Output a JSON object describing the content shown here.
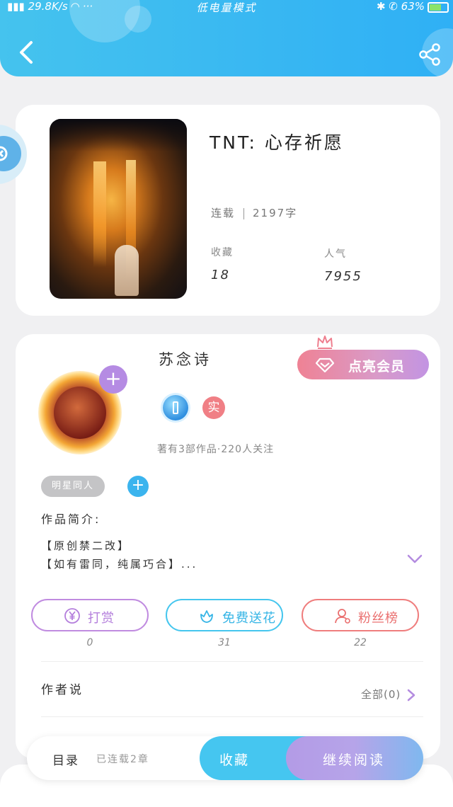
{
  "status_bar": {
    "speed": "29.8K/s",
    "mode": "低电量模式",
    "battery": "63%"
  },
  "book": {
    "title": "TNT: 心存祈愿",
    "serial_status": "连载",
    "word_count": "2197字",
    "collect_label": "收藏",
    "collect_value": "18",
    "popularity_label": "人气",
    "popularity_value": "7955"
  },
  "author": {
    "name": "苏念诗",
    "member_button": "点亮会员",
    "verified_badge": "实",
    "meta": "著有3部作品·220人关注",
    "tag": "明星同人",
    "intro_label": "作品简介:",
    "intro_lines": [
      "【原创禁二改】",
      "【如有雷同，纯属巧合】..."
    ]
  },
  "actions": [
    {
      "label": "打赏",
      "count": "0",
      "icon": "yen-icon"
    },
    {
      "label": "免费送花",
      "count": "31",
      "icon": "flower-icon"
    },
    {
      "label": "粉丝榜",
      "count": "22",
      "icon": "user-icon"
    }
  ],
  "author_says": {
    "label": "作者说",
    "all_link": "全部(0)"
  },
  "bottom_bar": {
    "toc_label": "目录",
    "toc_status": "已连载2章",
    "favorite_button": "收藏",
    "continue_button": "继续阅读"
  },
  "colors": {
    "header": "#38b7f2",
    "member_gradient_start": "#ef8294",
    "reward": "#b47fdc",
    "flower": "#36b5e6",
    "fans": "#ea7070"
  }
}
